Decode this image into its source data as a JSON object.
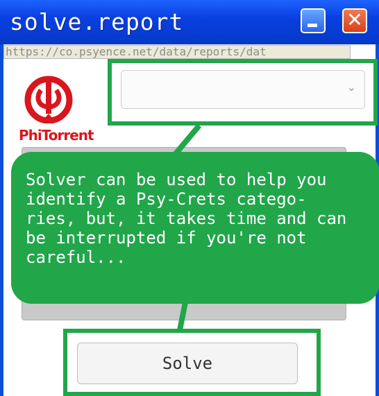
{
  "window": {
    "title": "solve.report",
    "close_glyph": "✕",
    "minimize_icon": "minimize-icon",
    "close_icon": "close-icon"
  },
  "address_bar": {
    "url": "https://co.psyence.net/data/reports/dat"
  },
  "logo": {
    "brand": "PhiTorrent",
    "icon": "phitorrent-logo-icon",
    "color": "#d9161d"
  },
  "category_select": {
    "selected": "",
    "chevron": "⌄"
  },
  "tooltip": {
    "text": "Solver can be used to help you\nidentify a Psy-Crets catego-\nries, but, it takes time and can\nbe interrupted if you're not\ncareful..."
  },
  "solve_button": {
    "label": "Solve"
  },
  "colors": {
    "titlebar": "#0a3fe0",
    "highlight": "#21a64a",
    "close_button": "#d8411a"
  }
}
